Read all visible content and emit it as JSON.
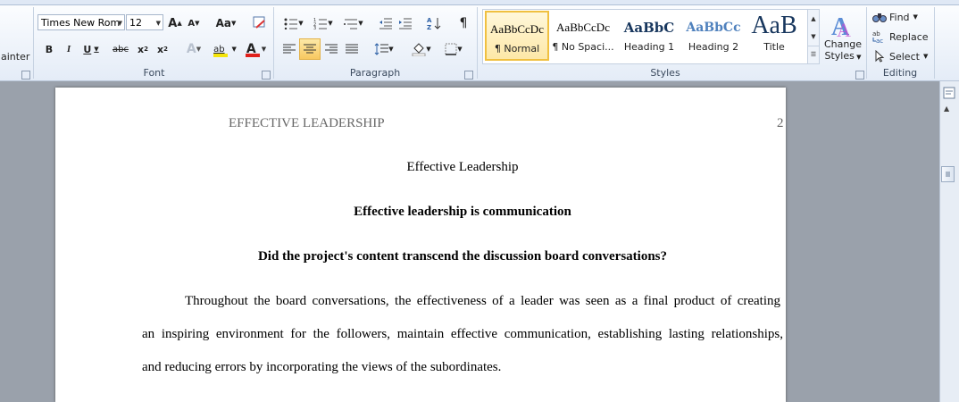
{
  "ribbon": {
    "clipboard": {
      "format_painter_label": "ainter"
    },
    "font": {
      "group_label": "Font",
      "font_name": "Times New Rom",
      "font_size": "12",
      "grow_label": "A",
      "shrink_label": "A",
      "case_label": "Aa",
      "bold_label": "B",
      "italic_label": "I",
      "underline_label": "U",
      "strike_label": "abc",
      "subscript_label": "x",
      "superscript_label": "x",
      "effects_label": "A",
      "highlight_label": "ab",
      "color_label": "A",
      "highlight_color": "#f5e50a",
      "font_color": "#e0201b"
    },
    "paragraph": {
      "group_label": "Paragraph",
      "pilcrow": "¶"
    },
    "styles": {
      "group_label": "Styles",
      "items": [
        {
          "preview": "AaBbCcDc",
          "name": "¶ Normal"
        },
        {
          "preview": "AaBbCcDc",
          "name": "¶ No Spaci..."
        },
        {
          "preview": "AaBbC",
          "name": "Heading 1"
        },
        {
          "preview": "AaBbCc",
          "name": "Heading 2"
        },
        {
          "preview": "AaB",
          "name": "Title"
        }
      ],
      "change_styles_line1": "Change",
      "change_styles_line2": "Styles",
      "heading_color": "#17365d"
    },
    "editing": {
      "group_label": "Editing",
      "find_label": "Find",
      "replace_label": "Replace",
      "select_label": "Select"
    }
  },
  "document": {
    "header_left": "EFFECTIVE LEADERSHIP",
    "page_number": "2",
    "title": "Effective Leadership",
    "heading": "Effective leadership is communication",
    "question": "Did the project's content transcend the discussion board conversations?",
    "paragraph_line1": "Throughout the board conversations, the effectiveness of a leader was seen as a final product of creating",
    "paragraph_line2": "an inspiring environment for the followers, maintain effective communication, establishing lasting relationships,",
    "paragraph_line3": "and reducing errors by incorporating the views of the subordinates."
  }
}
